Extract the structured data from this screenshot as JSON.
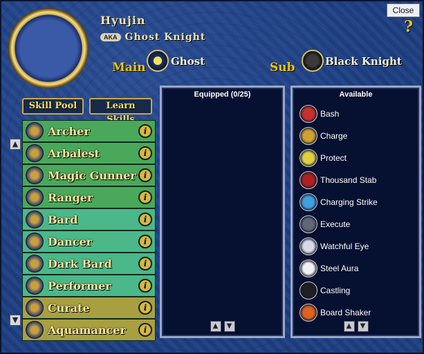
{
  "window": {
    "close_label": "Close",
    "help_label": "?"
  },
  "character": {
    "name": "Hyujin",
    "aka_label": "AKA",
    "title": "Ghost Knight"
  },
  "classes": {
    "main_label": "Main",
    "main_class": "Ghost",
    "sub_label": "Sub",
    "sub_class": "Black Knight"
  },
  "tabs": {
    "skill_pool": "Skill Pool",
    "learn_skills": "Learn Skills"
  },
  "skill_pool": {
    "info_label": "i",
    "items": [
      {
        "name": "Archer",
        "icon": "bow-arrow-icon",
        "color": "#4aa85a"
      },
      {
        "name": "Arbalest",
        "icon": "crossbow-icon",
        "color": "#4aa85a"
      },
      {
        "name": "Magic Gunner",
        "icon": "gun-icon",
        "color": "#4aa85a"
      },
      {
        "name": "Ranger",
        "icon": "longbow-icon",
        "color": "#4aa85a"
      },
      {
        "name": "Bard",
        "icon": "music-notes-icon",
        "color": "#4ab888"
      },
      {
        "name": "Dancer",
        "icon": "dancer-icon",
        "color": "#4ab888"
      },
      {
        "name": "Dark Bard",
        "icon": "dark-notes-icon",
        "color": "#4ab888"
      },
      {
        "name": "Performer",
        "icon": "juggling-balls-icon",
        "color": "#4ab888"
      },
      {
        "name": "Curate",
        "icon": "staff-icon",
        "color": "#a8a040"
      },
      {
        "name": "Aquamancer",
        "icon": "water-triangle-icon",
        "color": "#a8a040"
      }
    ]
  },
  "equipped": {
    "title": "Equipped (0/25)"
  },
  "available": {
    "title": "Available",
    "items": [
      {
        "name": "Bash",
        "icon": "bash-icon",
        "color": "#c83030"
      },
      {
        "name": "Charge",
        "icon": "charge-icon",
        "color": "#d0a030"
      },
      {
        "name": "Protect",
        "icon": "shield-icon",
        "color": "#e0d040"
      },
      {
        "name": "Thousand Stab",
        "icon": "stab-icon",
        "color": "#b02020"
      },
      {
        "name": "Charging Strike",
        "icon": "strike-icon",
        "color": "#40a0e0"
      },
      {
        "name": "Execute",
        "icon": "axe-icon",
        "color": "#606878"
      },
      {
        "name": "Watchful Eye",
        "icon": "eye-icon",
        "color": "#d8d8e8"
      },
      {
        "name": "Steel Aura",
        "icon": "checker-aura-icon",
        "color": "#f0f0f0"
      },
      {
        "name": "Castling",
        "icon": "rook-icon",
        "color": "#202020"
      },
      {
        "name": "Board Shaker",
        "icon": "explosion-icon",
        "color": "#e06020"
      }
    ]
  }
}
